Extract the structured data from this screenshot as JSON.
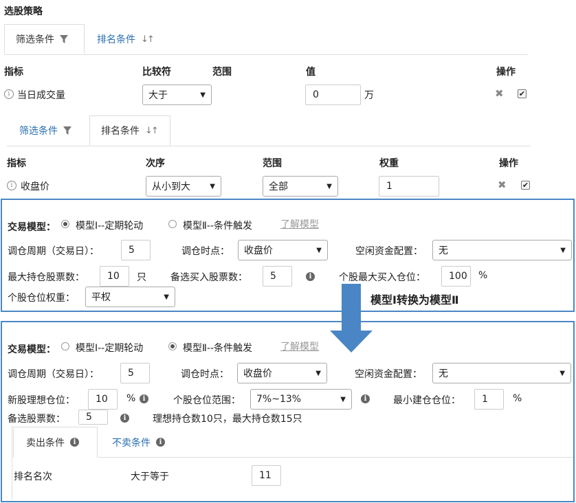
{
  "title": "选股策略",
  "top_tabs": {
    "filter": "筛选条件",
    "rank": "排名条件"
  },
  "filter_table": {
    "headers": {
      "indicator": "指标",
      "comparator": "比较符",
      "range": "范围",
      "value": "值",
      "action": "操作"
    },
    "row": {
      "indicator": "当日成交量",
      "comparator": "大于",
      "value": "0",
      "unit": "万"
    }
  },
  "rank_tabs": {
    "filter": "筛选条件",
    "rank": "排名条件"
  },
  "rank_table": {
    "headers": {
      "indicator": "指标",
      "order": "次序",
      "range": "范围",
      "weight": "权重",
      "action": "操作"
    },
    "row": {
      "indicator": "收盘价",
      "order": "从小到大",
      "range": "全部",
      "weight": "1"
    }
  },
  "model1": {
    "label": "交易模型：",
    "option1": "模型Ⅰ--定期轮动",
    "option2": "模型Ⅱ--条件触发",
    "learn": "了解模型",
    "cycle_label": "调仓周期（交易日）：",
    "cycle_value": "5",
    "timing_label": "调仓时点：",
    "timing_value": "收盘价",
    "idle_label": "空闲资金配置：",
    "idle_value": "无",
    "max_hold_label": "最大持仓股票数：",
    "max_hold_value": "10",
    "max_hold_unit": "只",
    "backup_label": "备选买入股票数：",
    "backup_value": "5",
    "single_max_label": "个股最大买入仓位：",
    "single_max_value": "100",
    "single_max_unit": "%",
    "weight_label": "个股仓位权重：",
    "weight_value": "平权"
  },
  "convert_label": "模型Ⅰ转换为模型Ⅱ",
  "model2": {
    "label": "交易模型：",
    "option1": "模型Ⅰ--定期轮动",
    "option2": "模型Ⅱ--条件触发",
    "learn": "了解模型",
    "cycle_label": "调仓周期（交易日）：",
    "cycle_value": "5",
    "timing_label": "调仓时点：",
    "timing_value": "收盘价",
    "idle_label": "空闲资金配置：",
    "idle_value": "无",
    "new_ideal_label": "新股理想仓位：",
    "new_ideal_value": "10",
    "new_ideal_unit": "%",
    "range_label": "个股仓位范围：",
    "range_value": "7%~13%",
    "min_build_label": "最小建仓仓位：",
    "min_build_value": "1",
    "min_build_unit": "%",
    "backup_label": "备选股票数：",
    "backup_value": "5",
    "hint": "理想持仓数10只，最大持仓数15只",
    "sell_tab": "卖出条件",
    "nosell_tab": "不卖条件",
    "rank_label": "排名名次",
    "rank_cmp": "大于等于",
    "rank_value": "11"
  }
}
